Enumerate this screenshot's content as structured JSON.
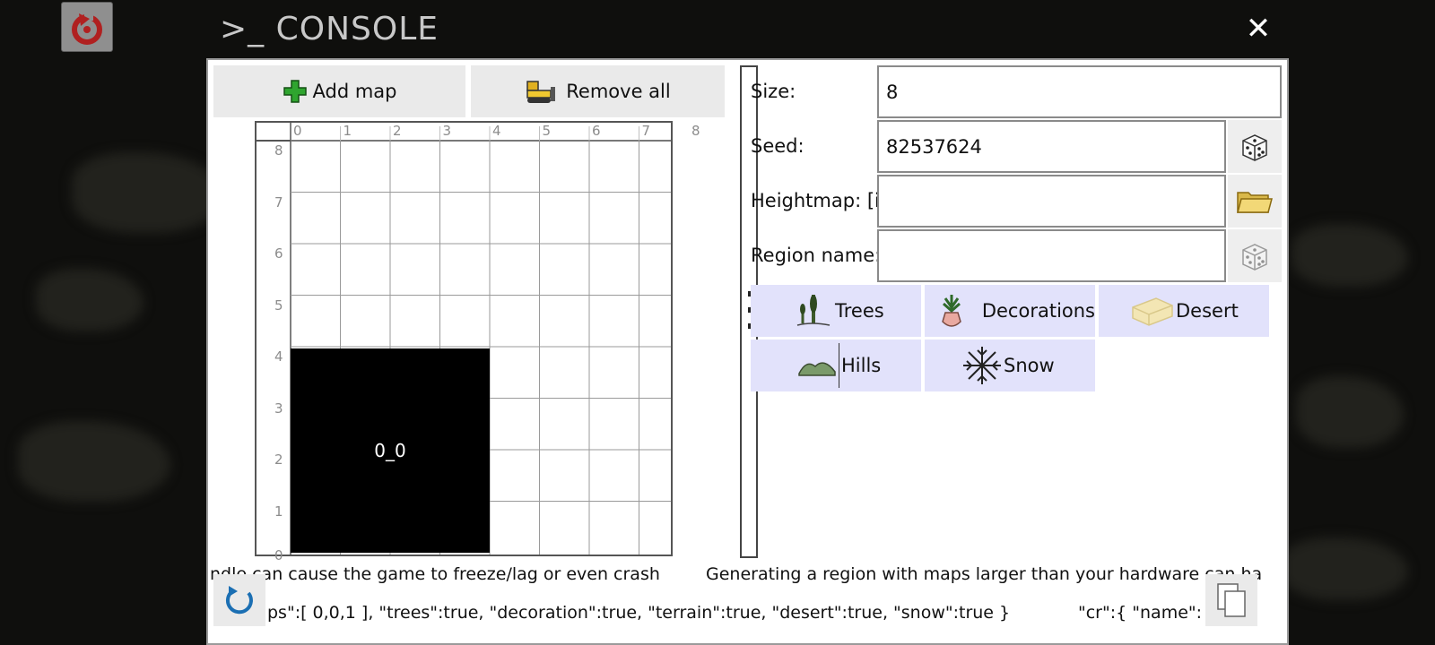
{
  "header": {
    "title": "CONSOLE",
    "close_glyph": "✕"
  },
  "toolbar": {
    "add_map_label": "Add map",
    "remove_all_label": "Remove all"
  },
  "grid": {
    "x_ticks": [
      "0",
      "1",
      "2",
      "3",
      "4",
      "5",
      "6",
      "7",
      "8"
    ],
    "y_ticks": [
      "8",
      "7",
      "6",
      "5",
      "4",
      "3",
      "2",
      "1",
      "0"
    ],
    "map_tile": {
      "label": "0_0",
      "x": 0,
      "y": 0,
      "size": 4
    }
  },
  "form": {
    "size_label": "Size:",
    "size_value": "8",
    "seed_label": "Seed:",
    "seed_value": "82537624",
    "heightmap_label": "Heightmap: [i]",
    "heightmap_value": "",
    "region_label": "Region name:",
    "region_value": ""
  },
  "toggles": {
    "trees": "Trees",
    "decorations": "Decorations",
    "desert": "Desert",
    "hills": "Hills",
    "snow": "Snow"
  },
  "messages": {
    "warning_left": "ndle can cause the game to freeze/lag or even crash",
    "warning_right": "Generating a region with maps larger than your hardware can ha",
    "command_left": "ps\":[   0,0,1  ],  \"trees\":true,  \"decoration\":true,  \"terrain\":true,  \"desert\":true,  \"snow\":true  }",
    "command_right": "\"cr\":{  \"name\":\"\",  \""
  },
  "colors": {
    "panel_bg": "#ffffff",
    "toggle_bg": "#e2e2fb",
    "button_bg": "#eaeaea",
    "map_tile": "#000000"
  },
  "icons": [
    "refresh-icon",
    "plus-icon",
    "bulldozer-icon",
    "dice-icon",
    "folder-icon",
    "trees-icon",
    "plant-pot-icon",
    "sand-icon",
    "hills-icon",
    "snowflake-icon",
    "copy-icon"
  ]
}
